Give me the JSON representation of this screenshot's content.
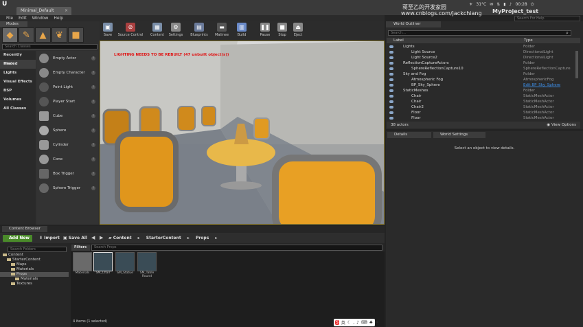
{
  "titlebar": {
    "tab_label": "Minimal_Default",
    "tab_close": "×",
    "project_name": "MyProject_test",
    "temperature": "31°C",
    "clock": "00:28",
    "watermark_line1": "蒋至乙的开发家园",
    "watermark_line2": "www.cnblogs.com/jackchiang"
  },
  "menu": [
    "File",
    "Edit",
    "Window",
    "Help"
  ],
  "search_help_placeholder": "Search For Help",
  "modes": {
    "title": "Modes",
    "search_placeholder": "Search Classes",
    "categories": [
      "Recently Placed",
      "Basic",
      "Lights",
      "Visual Effects",
      "BSP",
      "Volumes",
      "All Classes"
    ],
    "selected_category": "Basic",
    "items": [
      "Empty Actor",
      "Empty Character",
      "Point Light",
      "Player Start",
      "Cube",
      "Sphere",
      "Cylinder",
      "Cone",
      "Box Trigger",
      "Sphere Trigger"
    ]
  },
  "toolbar": [
    "Save",
    "Source Control",
    "Content",
    "Settings",
    "Blueprints",
    "Matinee",
    "Build",
    "Pause",
    "Stop",
    "Eject"
  ],
  "viewport": {
    "warning": "LIGHTING NEEDS TO BE REBUILT (47 unbuilt object(s))"
  },
  "outliner": {
    "title": "World Outliner",
    "search_placeholder": "Search...",
    "col_label": "Label",
    "col_type": "Type",
    "rows": [
      {
        "label": "Lights",
        "type": "Folder",
        "indent": 1
      },
      {
        "label": "Light Source",
        "type": "DirectionalLight",
        "indent": 2
      },
      {
        "label": "Light Source2",
        "type": "DirectionalLight",
        "indent": 2
      },
      {
        "label": "ReflectionCaptureActors",
        "type": "Folder",
        "indent": 1
      },
      {
        "label": "SphereReflectionCapture10",
        "type": "SphereReflectionCapture",
        "indent": 2
      },
      {
        "label": "Sky and Fog",
        "type": "Folder",
        "indent": 1
      },
      {
        "label": "Atmospheric Fog",
        "type": "AtmosphericFog",
        "indent": 2
      },
      {
        "label": "BP_Sky_Sphere",
        "type": "Edit BP_Sky_Sphere",
        "indent": 2,
        "link": true
      },
      {
        "label": "StaticMeshes",
        "type": "Folder",
        "indent": 1
      },
      {
        "label": "Chair",
        "type": "StaticMeshActor",
        "indent": 2
      },
      {
        "label": "Chair",
        "type": "StaticMeshActor",
        "indent": 2
      },
      {
        "label": "Chair2",
        "type": "StaticMeshActor",
        "indent": 2
      },
      {
        "label": "Floor",
        "type": "StaticMeshActor",
        "indent": 2
      },
      {
        "label": "Floor",
        "type": "StaticMeshActor",
        "indent": 2
      }
    ],
    "actor_count": "38 actors",
    "view_options": "View Options"
  },
  "details": {
    "tab1": "Details",
    "tab2": "World Settings",
    "empty_message": "Select an object to view details."
  },
  "content_browser": {
    "tab": "Content Browser",
    "add_new": "Add New",
    "import": "Import",
    "save_all": "Save All",
    "breadcrumb": [
      "Content",
      "StarterContent",
      "Props"
    ],
    "folder_search_placeholder": "Search Folders",
    "filters": "Filters",
    "asset_search_placeholder": "Search Props",
    "tree": [
      {
        "label": "Content",
        "indent": 0
      },
      {
        "label": "StarterContent",
        "indent": 1
      },
      {
        "label": "Maps",
        "indent": 2
      },
      {
        "label": "Materials",
        "indent": 2
      },
      {
        "label": "Props",
        "indent": 2,
        "selected": true
      },
      {
        "label": "Materials",
        "indent": 3
      },
      {
        "label": "Textures",
        "indent": 2
      }
    ],
    "assets": [
      {
        "label": "Materials",
        "kind": "folder"
      },
      {
        "label": "SM_Chair",
        "kind": "mesh"
      },
      {
        "label": "SM_Statue",
        "kind": "mesh"
      },
      {
        "label": "SM_Table\nRound",
        "kind": "mesh"
      }
    ],
    "status": "4 items (1 selected)"
  },
  "colors": {
    "chair_orange": "#f0a020",
    "accent_green": "#4a8a2a",
    "warning_red": "#e01010",
    "link_blue": "#3d8ee6"
  }
}
